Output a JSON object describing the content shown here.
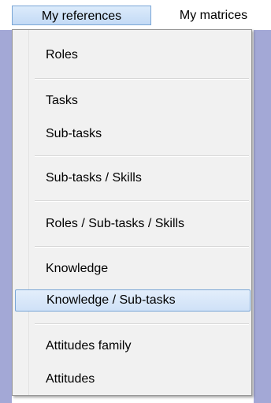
{
  "menubar": {
    "items": [
      {
        "label": "My references"
      },
      {
        "label": "My matrices"
      }
    ]
  },
  "dropdown": {
    "items": [
      {
        "label": "Roles"
      },
      {
        "label": "Tasks"
      },
      {
        "label": "Sub-tasks"
      },
      {
        "label": "Sub-tasks / Skills"
      },
      {
        "label": "Roles / Sub-tasks / Skills"
      },
      {
        "label": "Knowledge"
      },
      {
        "label": "Knowledge / Sub-tasks"
      },
      {
        "label": "Attitudes family"
      },
      {
        "label": "Attitudes"
      }
    ],
    "highlighted": "Knowledge / Sub-tasks"
  },
  "colors": {
    "highlight_border": "#7aa6d6",
    "highlight_fill": "#cfe1f7",
    "background_strip": "#a3a8d6",
    "menu_background": "#f1f1f1"
  }
}
